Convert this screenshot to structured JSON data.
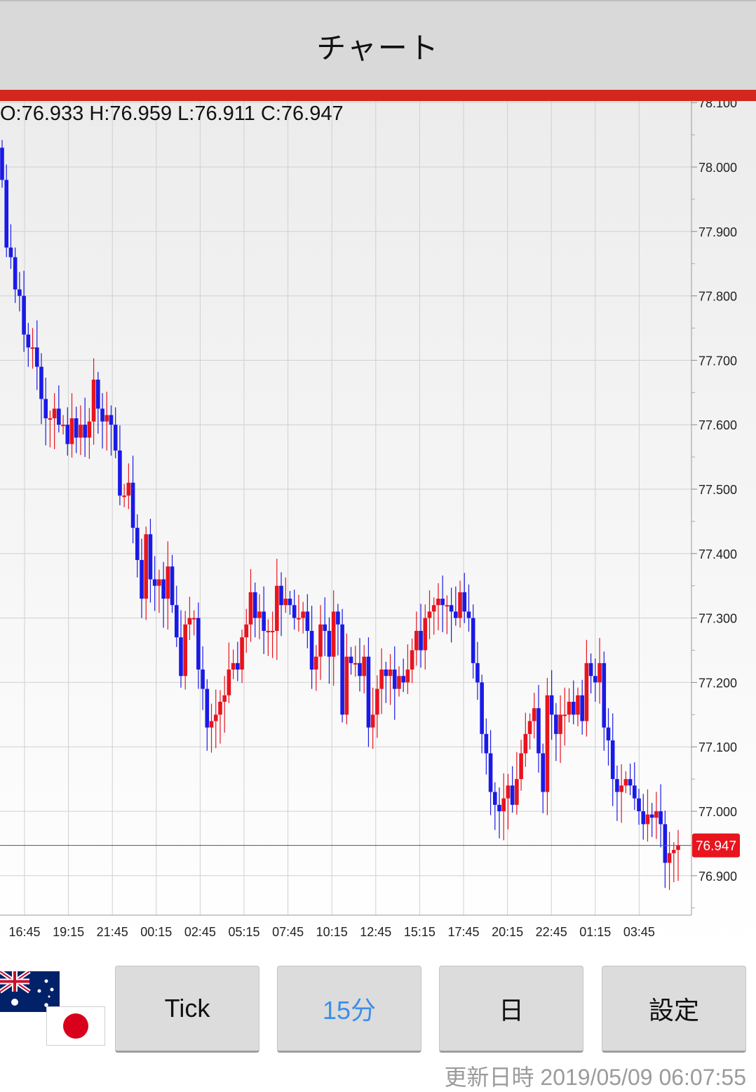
{
  "header": {
    "title": "チャート"
  },
  "ohlc": {
    "text": "O:76.933 H:76.959 L:76.911 C:76.947"
  },
  "buttons": {
    "tick": "Tick",
    "min15": "15分",
    "day": "日",
    "settings": "設定"
  },
  "flags": {
    "base": "australia-flag-icon",
    "quote": "japan-flag-icon"
  },
  "footer": {
    "update_label": "更新日時",
    "update_time": "2019/05/09 06:07:55"
  },
  "colors": {
    "up": "#e8141e",
    "down": "#1a1ae6",
    "current_price_badge": "#e8141e",
    "header_bar": "#d3271d"
  },
  "chart_data": {
    "type": "candlestick",
    "current_price": 76.947,
    "current_price_label": "76.947",
    "ylim": [
      76.84,
      78.1
    ],
    "y_ticks": [
      "76.900",
      "77.000",
      "77.100",
      "77.200",
      "77.300",
      "77.400",
      "77.500",
      "77.600",
      "77.700",
      "77.800",
      "77.900",
      "78.000",
      "78.100"
    ],
    "y_tick_values": [
      76.9,
      77.0,
      77.1,
      77.2,
      77.3,
      77.4,
      77.5,
      77.6,
      77.7,
      77.8,
      77.9,
      78.0,
      78.1
    ],
    "x_ticks": [
      "16:45",
      "19:15",
      "21:45",
      "00:15",
      "02:45",
      "05:15",
      "07:45",
      "10:15",
      "12:45",
      "15:15",
      "17:45",
      "20:15",
      "22:45",
      "01:15",
      "03:45"
    ],
    "candle_count": 156,
    "closes": [
      77.98,
      77.875,
      77.86,
      77.81,
      77.8,
      77.74,
      77.72,
      77.72,
      77.69,
      77.64,
      77.61,
      77.61,
      77.625,
      77.6,
      77.6,
      77.57,
      77.61,
      77.58,
      77.6,
      77.58,
      77.605,
      77.67,
      77.625,
      77.605,
      77.615,
      77.6,
      77.56,
      77.49,
      77.49,
      77.51,
      77.44,
      77.39,
      77.33,
      77.43,
      77.36,
      77.35,
      77.36,
      77.33,
      77.38,
      77.32,
      77.27,
      77.21,
      77.29,
      77.3,
      77.3,
      77.22,
      77.19,
      77.13,
      77.14,
      77.15,
      77.17,
      77.18,
      77.22,
      77.23,
      77.22,
      77.27,
      77.29,
      77.34,
      77.3,
      77.31,
      77.28,
      77.28,
      77.28,
      77.35,
      77.32,
      77.33,
      77.32,
      77.3,
      77.3,
      77.31,
      77.28,
      77.22,
      77.24,
      77.29,
      77.28,
      77.24,
      77.31,
      77.29,
      77.15,
      77.24,
      77.23,
      77.23,
      77.21,
      77.24,
      77.13,
      77.15,
      77.19,
      77.22,
      77.21,
      77.22,
      77.19,
      77.21,
      77.2,
      77.22,
      77.25,
      77.28,
      77.25,
      77.3,
      77.31,
      77.32,
      77.33,
      77.32,
      77.32,
      77.31,
      77.3,
      77.34,
      77.31,
      77.3,
      77.23,
      77.2,
      77.12,
      77.09,
      77.03,
      77.01,
      77.0,
      77.02,
      77.04,
      77.01,
      77.05,
      77.09,
      77.12,
      77.14,
      77.16,
      77.09,
      77.03,
      77.18,
      77.15,
      77.12,
      77.15,
      77.15,
      77.17,
      77.15,
      77.18,
      77.14,
      77.23,
      77.21,
      77.2,
      77.23,
      77.13,
      77.11,
      77.05,
      77.03,
      77.04,
      77.05,
      77.04,
      77.02,
      77.0,
      76.98,
      76.995,
      76.99,
      77.0,
      76.98,
      76.92,
      76.935,
      76.94,
      76.947
    ]
  }
}
